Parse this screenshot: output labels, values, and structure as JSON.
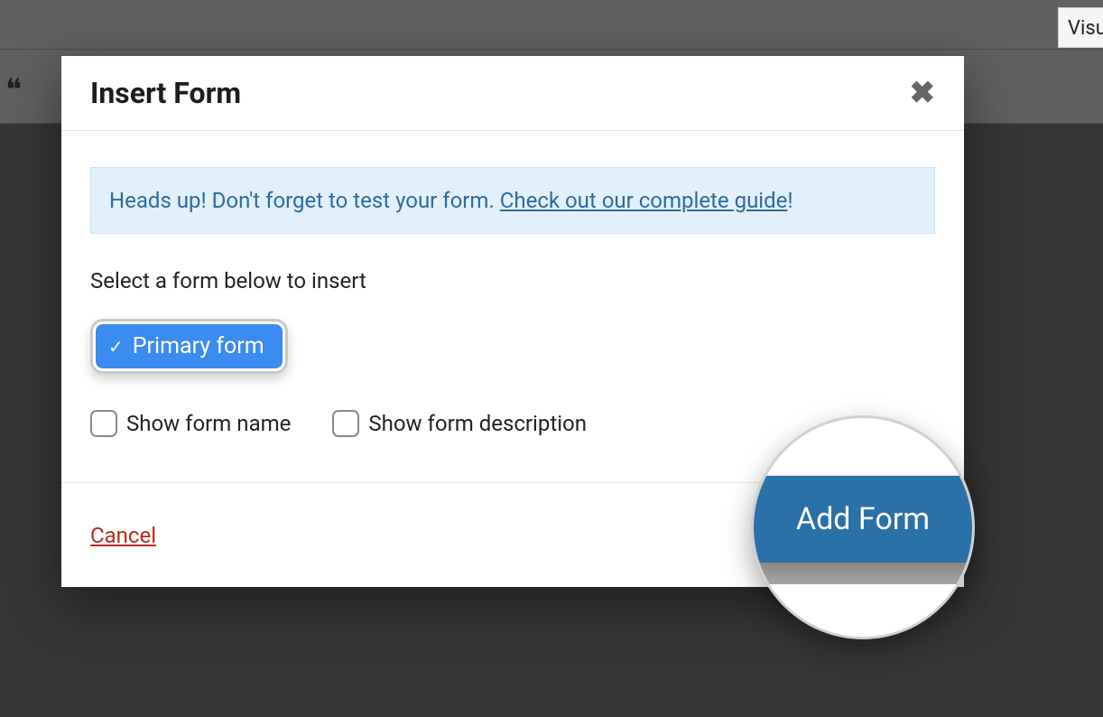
{
  "editor": {
    "hidden_tab_label": "Visu"
  },
  "modal": {
    "title": "Insert Form",
    "notice_prefix": "Heads up! Don't forget to test your form. ",
    "notice_link": "Check out our complete guide",
    "notice_suffix": "!",
    "select_label": "Select a form below to insert",
    "selected_form": "Primary form",
    "checkbox_show_name": "Show form name",
    "checkbox_show_desc": "Show form description",
    "cancel_label": "Cancel",
    "submit_label": "Add Form"
  },
  "magnifier": {
    "button_label": "Add Form"
  }
}
